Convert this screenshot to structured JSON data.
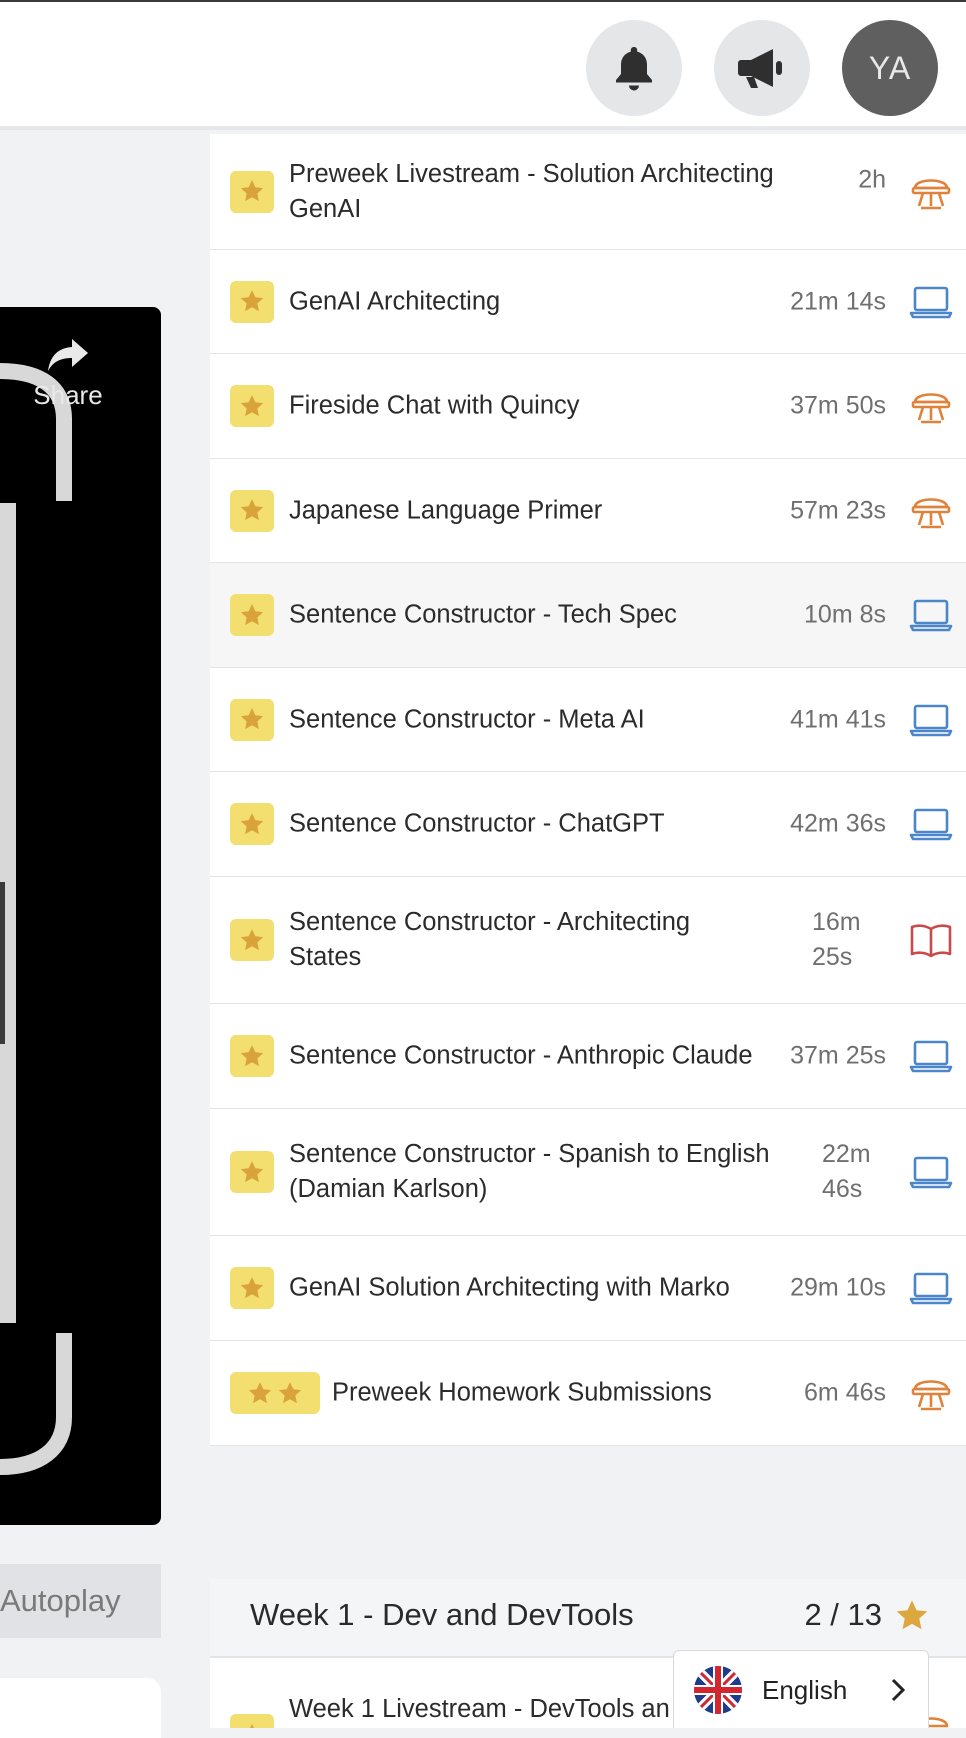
{
  "header": {
    "avatar_initials": "YA",
    "icons": [
      "bell-icon",
      "megaphone-icon"
    ]
  },
  "player": {
    "share_label": "Share",
    "autoplay_label": "Autoplay"
  },
  "lessons": [
    {
      "title": "Preweek Livestream - Solution Architecting GenAI",
      "duration": "2h",
      "stars": 1,
      "type": "livestream"
    },
    {
      "title": "GenAI Architecting",
      "duration": "21m 14s",
      "stars": 1,
      "type": "laptop"
    },
    {
      "title": "Fireside Chat with Quincy",
      "duration": "37m 50s",
      "stars": 1,
      "type": "livestream"
    },
    {
      "title": "Japanese Language Primer",
      "duration": "57m 23s",
      "stars": 1,
      "type": "livestream"
    },
    {
      "title": "Sentence Constructor - Tech Spec",
      "duration": "10m 8s",
      "stars": 1,
      "type": "laptop"
    },
    {
      "title": "Sentence Constructor - Meta AI",
      "duration": "41m 41s",
      "stars": 1,
      "type": "laptop"
    },
    {
      "title": "Sentence Constructor - ChatGPT",
      "duration": "42m 36s",
      "stars": 1,
      "type": "laptop"
    },
    {
      "title": "Sentence Constructor - Architecting States",
      "duration": "16m 25s",
      "stars": 1,
      "type": "book"
    },
    {
      "title": "Sentence Constructor - Anthropic Claude",
      "duration": "37m 25s",
      "stars": 1,
      "type": "laptop"
    },
    {
      "title": "Sentence Constructor - Spanish to English (Damian Karlson)",
      "duration": "22m 46s",
      "stars": 1,
      "type": "laptop"
    },
    {
      "title": "GenAI Solution Architecting with Marko",
      "duration": "29m 10s",
      "stars": 1,
      "type": "laptop"
    },
    {
      "title": "Preweek Homework Submissions",
      "duration": "6m 46s",
      "stars": 2,
      "type": "livestream"
    }
  ],
  "week": {
    "title": "Week 1 - Dev and DevTools",
    "progress": "2 / 13"
  },
  "next_lesson": {
    "title": "Week 1 Livestream - DevTools an",
    "type": "livestream"
  },
  "language": {
    "label": "English"
  },
  "colors": {
    "star_bg": "#f2df6f",
    "star": "#d9a23a",
    "livestream": "#e0823a",
    "laptop": "#4a86c8",
    "book": "#c94a4a"
  }
}
